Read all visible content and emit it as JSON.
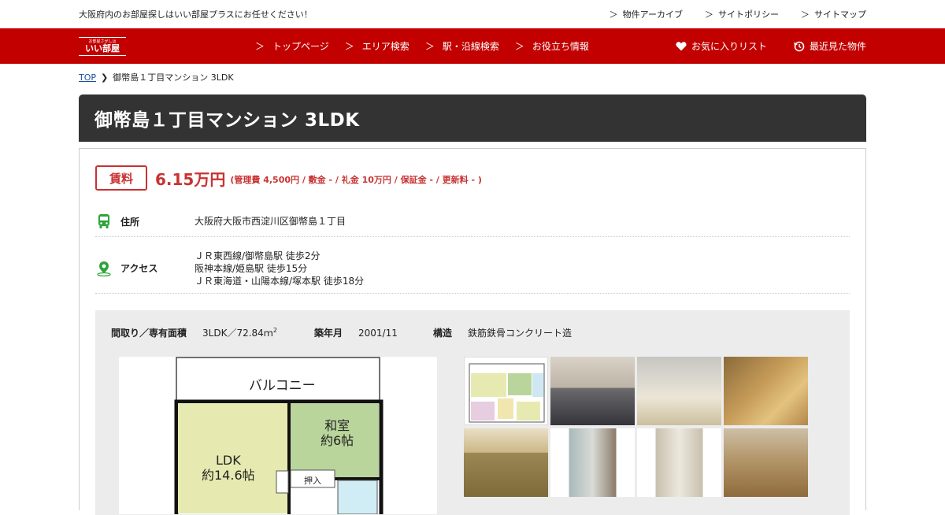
{
  "header": {
    "tagline": "大阪府内のお部屋探しはいい部屋プラスにお任せください！",
    "top_links": [
      "物件アーカイブ",
      "サイトポリシー",
      "サイトマップ"
    ]
  },
  "logo": {
    "small": "お部屋さがしは",
    "main": "いい部屋"
  },
  "nav": {
    "items": [
      "トップページ",
      "エリア検索",
      "駅・沿線検索",
      "お役立ち情報"
    ],
    "favorites": "お気に入りリスト",
    "recent": "最近見た物件"
  },
  "breadcrumb": {
    "top": "TOP",
    "current": "御幣島１丁目マンション 3LDK"
  },
  "property": {
    "title": "御幣島１丁目マンション  3LDK",
    "rent_label": "賃料",
    "rent": "6.15万円",
    "fees": "(管理費 4,500円 / 敷金 - / 礼金 10万円 / 保証金 - / 更新料 - )",
    "address_label": "住所",
    "address": "大阪府大阪市西淀川区御幣島１丁目",
    "access_label": "アクセス",
    "access": [
      "ＪＲ東西線/御幣島駅 徒歩2分",
      "阪神本線/姫島駅 徒歩15分",
      "ＪＲ東海道・山陽本線/塚本駅 徒歩18分"
    ],
    "layout_label": "間取り／専有面積",
    "layout_value": "3LDK／72.84ｍ",
    "layout_sup": "2",
    "built_label": "築年月",
    "built_value": "2001/11",
    "structure_label": "構造",
    "structure_value": "鉄筋鉄骨コンクリート造"
  },
  "floorplan": {
    "balcony": "バルコニー",
    "washitsu": "和室",
    "washitsu_size": "約6帖",
    "ldk": "LDK",
    "ldk_size": "約14.6帖",
    "closet": "押入"
  },
  "colors": {
    "brand_red": "#c20000",
    "price_red": "#c83232",
    "title_bg": "#333333",
    "icon_green": "#2ea43a"
  },
  "icons": [
    "heart-icon",
    "history-icon",
    "bus-icon",
    "location-pin-icon"
  ]
}
